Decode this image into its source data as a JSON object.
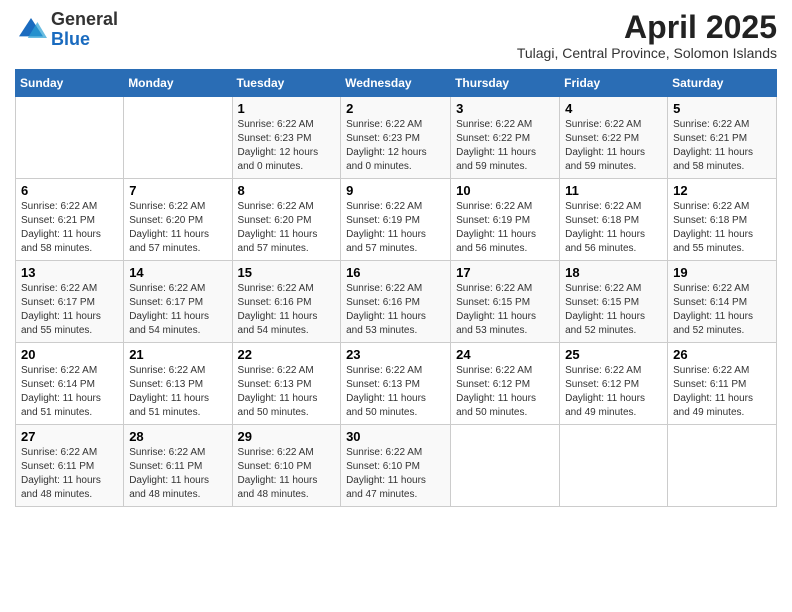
{
  "logo": {
    "general": "General",
    "blue": "Blue"
  },
  "title": {
    "month_year": "April 2025",
    "location": "Tulagi, Central Province, Solomon Islands"
  },
  "weekdays": [
    "Sunday",
    "Monday",
    "Tuesday",
    "Wednesday",
    "Thursday",
    "Friday",
    "Saturday"
  ],
  "weeks": [
    [
      {
        "day": "",
        "info": ""
      },
      {
        "day": "",
        "info": ""
      },
      {
        "day": "1",
        "info": "Sunrise: 6:22 AM\nSunset: 6:23 PM\nDaylight: 12 hours and 0 minutes."
      },
      {
        "day": "2",
        "info": "Sunrise: 6:22 AM\nSunset: 6:23 PM\nDaylight: 12 hours and 0 minutes."
      },
      {
        "day": "3",
        "info": "Sunrise: 6:22 AM\nSunset: 6:22 PM\nDaylight: 11 hours and 59 minutes."
      },
      {
        "day": "4",
        "info": "Sunrise: 6:22 AM\nSunset: 6:22 PM\nDaylight: 11 hours and 59 minutes."
      },
      {
        "day": "5",
        "info": "Sunrise: 6:22 AM\nSunset: 6:21 PM\nDaylight: 11 hours and 58 minutes."
      }
    ],
    [
      {
        "day": "6",
        "info": "Sunrise: 6:22 AM\nSunset: 6:21 PM\nDaylight: 11 hours and 58 minutes."
      },
      {
        "day": "7",
        "info": "Sunrise: 6:22 AM\nSunset: 6:20 PM\nDaylight: 11 hours and 57 minutes."
      },
      {
        "day": "8",
        "info": "Sunrise: 6:22 AM\nSunset: 6:20 PM\nDaylight: 11 hours and 57 minutes."
      },
      {
        "day": "9",
        "info": "Sunrise: 6:22 AM\nSunset: 6:19 PM\nDaylight: 11 hours and 57 minutes."
      },
      {
        "day": "10",
        "info": "Sunrise: 6:22 AM\nSunset: 6:19 PM\nDaylight: 11 hours and 56 minutes."
      },
      {
        "day": "11",
        "info": "Sunrise: 6:22 AM\nSunset: 6:18 PM\nDaylight: 11 hours and 56 minutes."
      },
      {
        "day": "12",
        "info": "Sunrise: 6:22 AM\nSunset: 6:18 PM\nDaylight: 11 hours and 55 minutes."
      }
    ],
    [
      {
        "day": "13",
        "info": "Sunrise: 6:22 AM\nSunset: 6:17 PM\nDaylight: 11 hours and 55 minutes."
      },
      {
        "day": "14",
        "info": "Sunrise: 6:22 AM\nSunset: 6:17 PM\nDaylight: 11 hours and 54 minutes."
      },
      {
        "day": "15",
        "info": "Sunrise: 6:22 AM\nSunset: 6:16 PM\nDaylight: 11 hours and 54 minutes."
      },
      {
        "day": "16",
        "info": "Sunrise: 6:22 AM\nSunset: 6:16 PM\nDaylight: 11 hours and 53 minutes."
      },
      {
        "day": "17",
        "info": "Sunrise: 6:22 AM\nSunset: 6:15 PM\nDaylight: 11 hours and 53 minutes."
      },
      {
        "day": "18",
        "info": "Sunrise: 6:22 AM\nSunset: 6:15 PM\nDaylight: 11 hours and 52 minutes."
      },
      {
        "day": "19",
        "info": "Sunrise: 6:22 AM\nSunset: 6:14 PM\nDaylight: 11 hours and 52 minutes."
      }
    ],
    [
      {
        "day": "20",
        "info": "Sunrise: 6:22 AM\nSunset: 6:14 PM\nDaylight: 11 hours and 51 minutes."
      },
      {
        "day": "21",
        "info": "Sunrise: 6:22 AM\nSunset: 6:13 PM\nDaylight: 11 hours and 51 minutes."
      },
      {
        "day": "22",
        "info": "Sunrise: 6:22 AM\nSunset: 6:13 PM\nDaylight: 11 hours and 50 minutes."
      },
      {
        "day": "23",
        "info": "Sunrise: 6:22 AM\nSunset: 6:13 PM\nDaylight: 11 hours and 50 minutes."
      },
      {
        "day": "24",
        "info": "Sunrise: 6:22 AM\nSunset: 6:12 PM\nDaylight: 11 hours and 50 minutes."
      },
      {
        "day": "25",
        "info": "Sunrise: 6:22 AM\nSunset: 6:12 PM\nDaylight: 11 hours and 49 minutes."
      },
      {
        "day": "26",
        "info": "Sunrise: 6:22 AM\nSunset: 6:11 PM\nDaylight: 11 hours and 49 minutes."
      }
    ],
    [
      {
        "day": "27",
        "info": "Sunrise: 6:22 AM\nSunset: 6:11 PM\nDaylight: 11 hours and 48 minutes."
      },
      {
        "day": "28",
        "info": "Sunrise: 6:22 AM\nSunset: 6:11 PM\nDaylight: 11 hours and 48 minutes."
      },
      {
        "day": "29",
        "info": "Sunrise: 6:22 AM\nSunset: 6:10 PM\nDaylight: 11 hours and 48 minutes."
      },
      {
        "day": "30",
        "info": "Sunrise: 6:22 AM\nSunset: 6:10 PM\nDaylight: 11 hours and 47 minutes."
      },
      {
        "day": "",
        "info": ""
      },
      {
        "day": "",
        "info": ""
      },
      {
        "day": "",
        "info": ""
      }
    ]
  ]
}
